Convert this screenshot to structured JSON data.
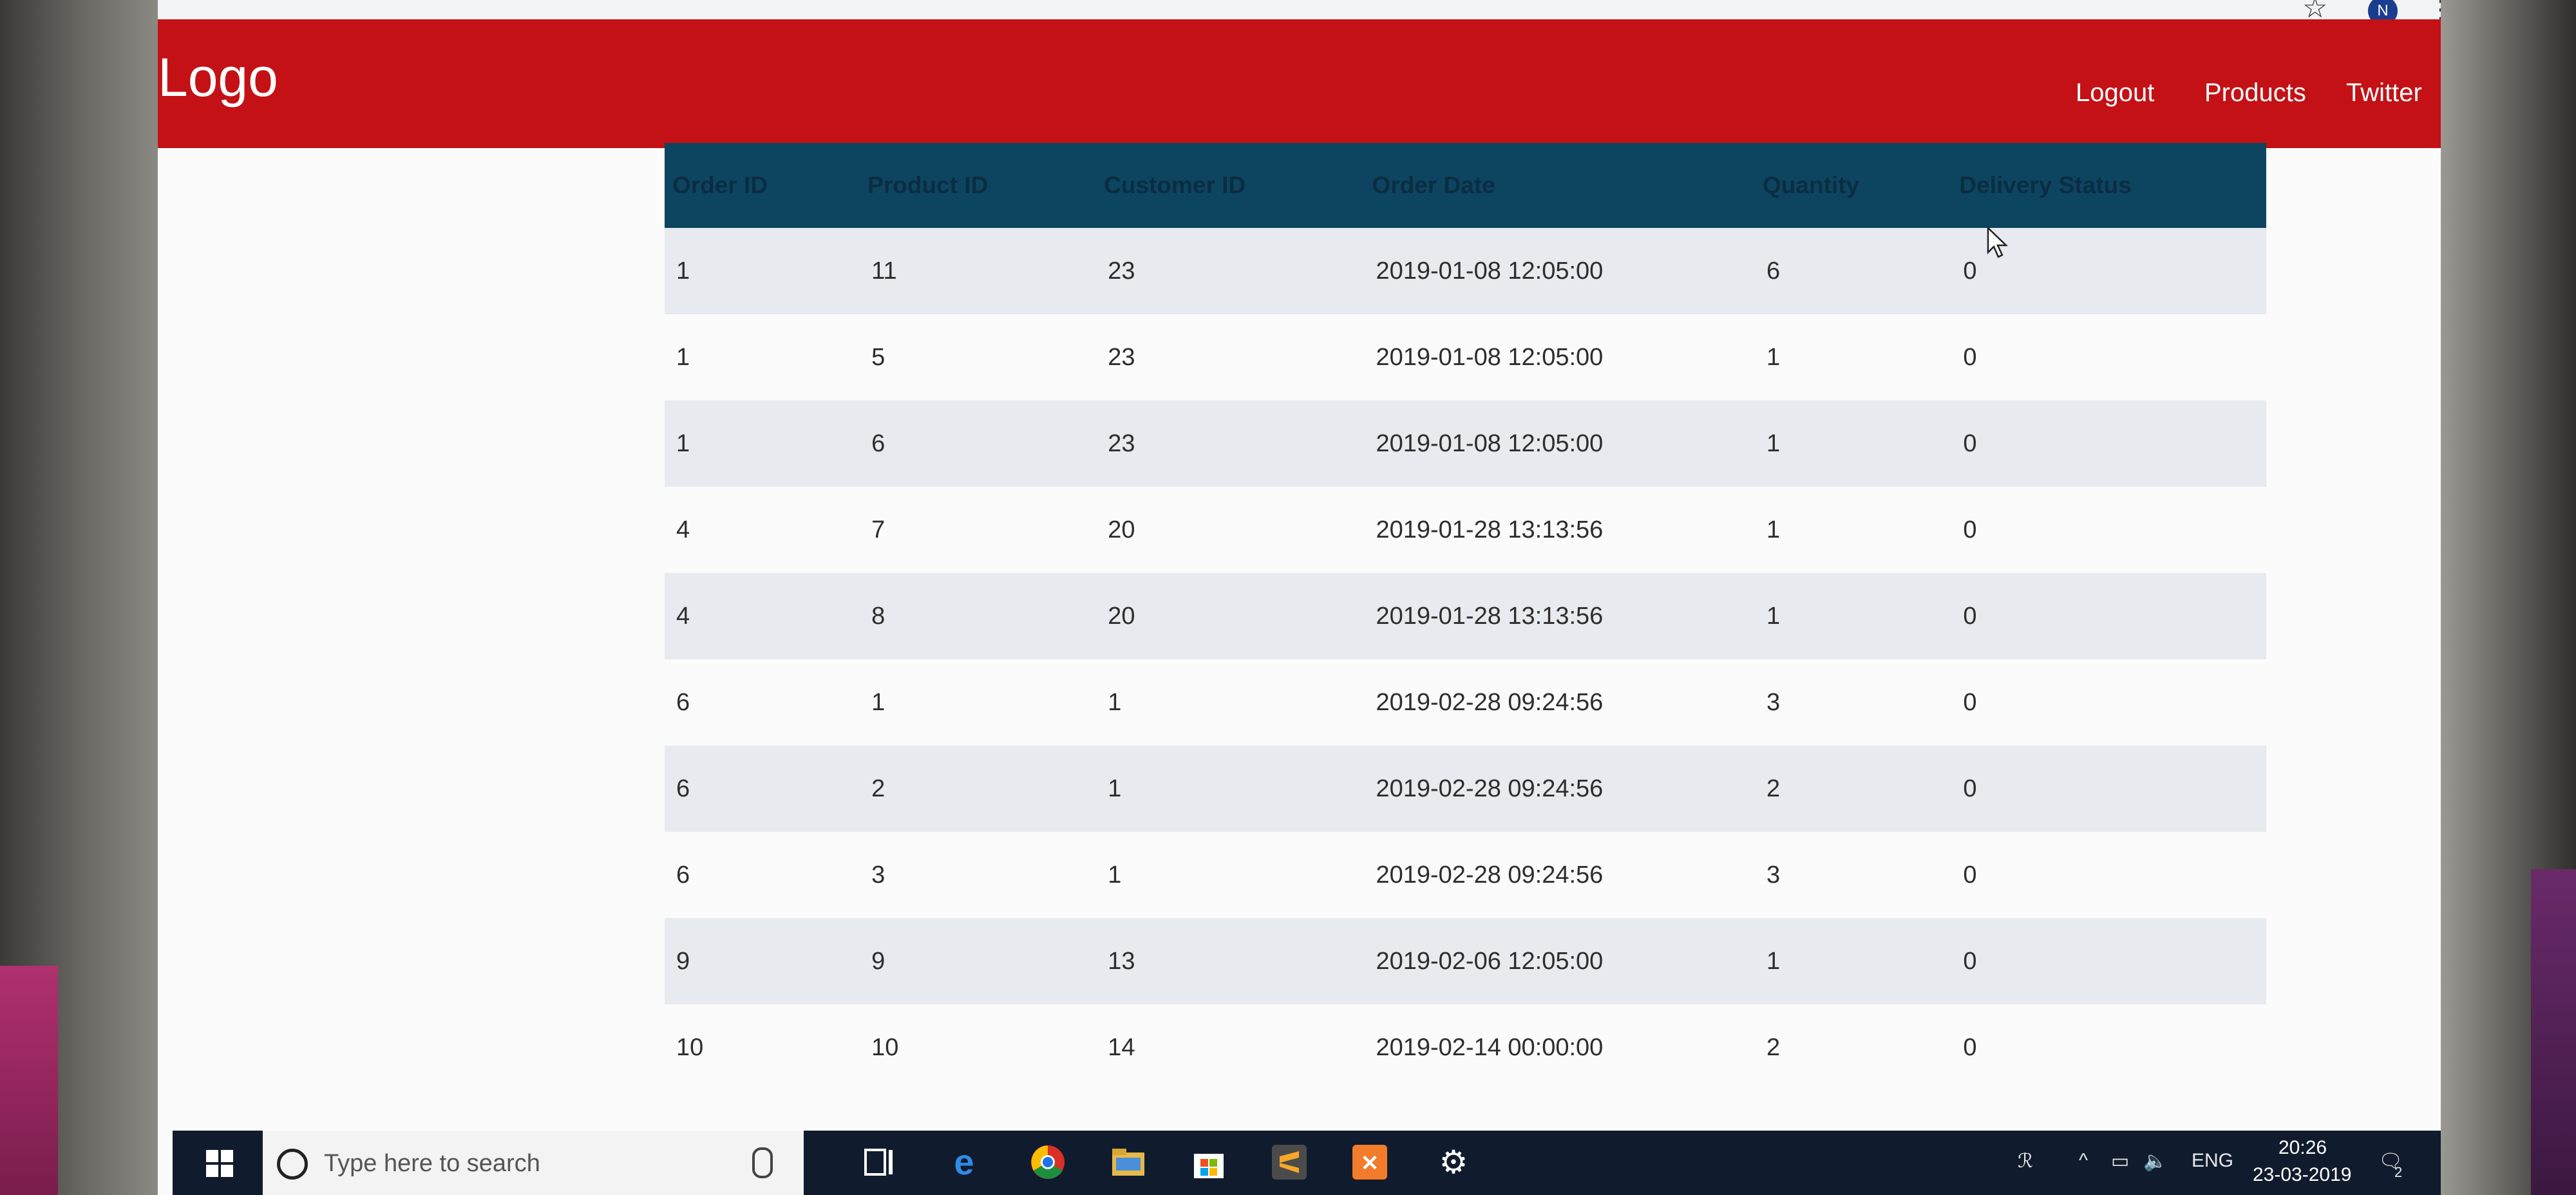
{
  "browser": {
    "star_label": "☆",
    "profile_initial": "N",
    "menu_label": "⋮"
  },
  "header": {
    "logo": "Logo",
    "nav": [
      {
        "label": "Logout"
      },
      {
        "label": "Products"
      },
      {
        "label": "Twitter"
      }
    ],
    "brand_color": "#c41115"
  },
  "table": {
    "columns": [
      "Order ID",
      "Product ID",
      "Customer ID",
      "Order Date",
      "Quantity",
      "Delivery Status"
    ],
    "rows": [
      [
        "1",
        "11",
        "23",
        "2019-01-08 12:05:00",
        "6",
        "0"
      ],
      [
        "1",
        "5",
        "23",
        "2019-01-08 12:05:00",
        "1",
        "0"
      ],
      [
        "1",
        "6",
        "23",
        "2019-01-08 12:05:00",
        "1",
        "0"
      ],
      [
        "4",
        "7",
        "20",
        "2019-01-28 13:13:56",
        "1",
        "0"
      ],
      [
        "4",
        "8",
        "20",
        "2019-01-28 13:13:56",
        "1",
        "0"
      ],
      [
        "6",
        "1",
        "1",
        "2019-02-28 09:24:56",
        "3",
        "0"
      ],
      [
        "6",
        "2",
        "1",
        "2019-02-28 09:24:56",
        "2",
        "0"
      ],
      [
        "6",
        "3",
        "1",
        "2019-02-28 09:24:56",
        "3",
        "0"
      ],
      [
        "9",
        "9",
        "13",
        "2019-02-06 12:05:00",
        "1",
        "0"
      ],
      [
        "10",
        "10",
        "14",
        "2019-02-14 00:00:00",
        "2",
        "0"
      ]
    ],
    "header_color": "#0d4560"
  },
  "taskbar": {
    "search_placeholder": "Type here to search",
    "tray": {
      "language": "ENG",
      "time": "20:26",
      "date": "23-03-2019",
      "notification_count": "2"
    }
  }
}
